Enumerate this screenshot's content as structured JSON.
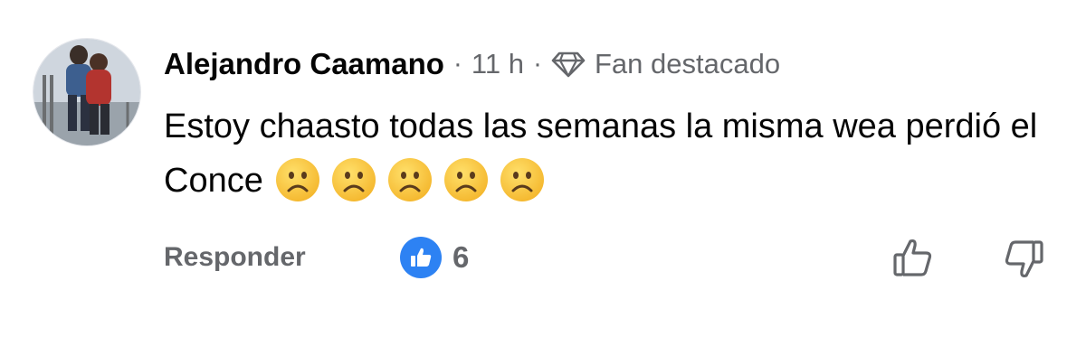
{
  "comment": {
    "author": "Alejandro Caamano",
    "separator": "·",
    "time": "11 h",
    "badge_icon": "diamond-icon",
    "badge_label": "Fan destacado",
    "text": "Estoy chaasto todas las semanas la misma wea perdió el Conce",
    "emojis": [
      "☹️",
      "☹️",
      "☹️",
      "☹️",
      "☹️"
    ]
  },
  "actions": {
    "reply_label": "Responder",
    "reaction_icon": "thumbs-up-icon",
    "reaction_count": "6",
    "upvote_icon": "thumbs-up-outline-icon",
    "downvote_icon": "thumbs-down-outline-icon"
  },
  "colors": {
    "text_primary": "#050505",
    "text_secondary": "#65676b",
    "like_blue": "#2d82f3",
    "emoji_yellow": "#fbc83a"
  }
}
